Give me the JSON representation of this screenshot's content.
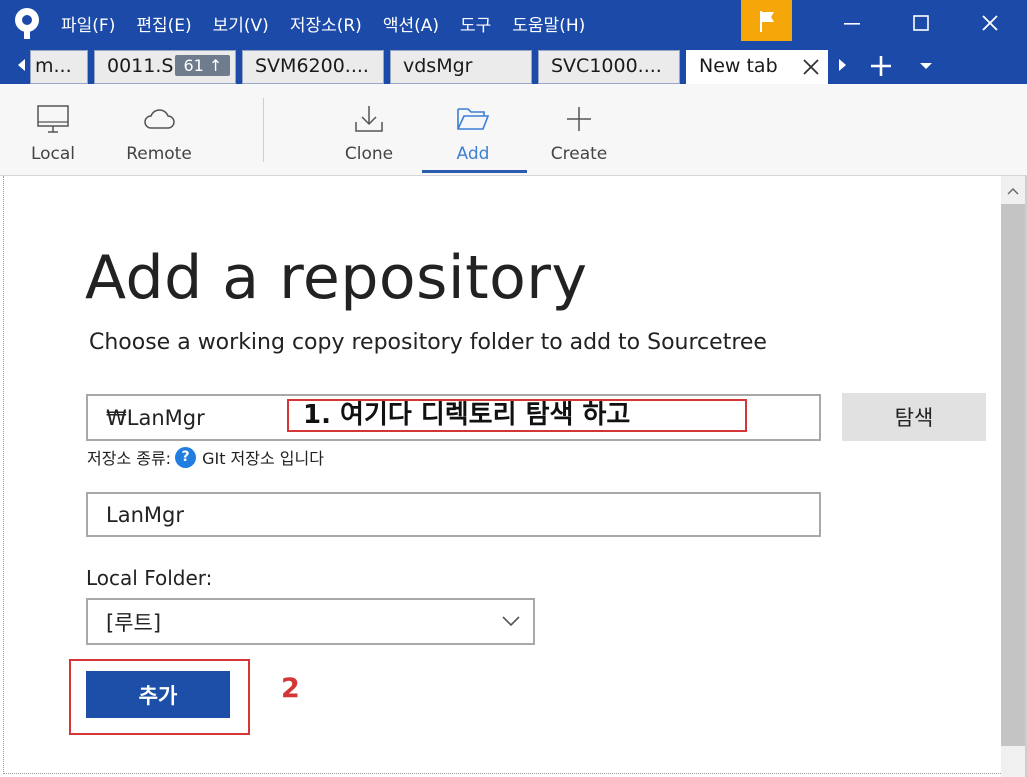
{
  "app": {
    "brand_color": "#1c4aa8",
    "accent_color": "#3d7fd6",
    "flag_color": "#f5a70a",
    "annotation_color": "#d43535"
  },
  "menu": {
    "items": [
      "파일(F)",
      "편집(E)",
      "보기(V)",
      "저장소(R)",
      "액션(A)",
      "도구",
      "도움말(H)"
    ]
  },
  "window": {
    "minimize_icon": "minimize-icon",
    "maximize_icon": "maximize-icon",
    "close_icon": "close-icon",
    "flag_icon": "flag-icon"
  },
  "tabs": {
    "items": [
      {
        "label": "m..."
      },
      {
        "label": "0011.S",
        "badge": "61 ↑"
      },
      {
        "label": "SVM6200...."
      },
      {
        "label": "vdsMgr"
      },
      {
        "label": "SVC1000...."
      },
      {
        "label": "New tab",
        "active": true
      }
    ]
  },
  "toolbar": {
    "local": "Local",
    "remote": "Remote",
    "clone": "Clone",
    "add": "Add",
    "create": "Create",
    "selected": "add"
  },
  "page": {
    "title": "Add a repository",
    "subtitle": "Choose a working copy repository folder to add to Sourcetree"
  },
  "form": {
    "path_value": "₩LanMgr",
    "browse_label": "탐색",
    "repo_type_prefix": "저장소 종류:",
    "repo_type_help": "?",
    "repo_type_text": "GIt 저장소 입니다",
    "name_value": "LanMgr",
    "local_folder_label": "Local Folder:",
    "local_folder_selected": "[루트]",
    "add_button": "추가"
  },
  "annotations": {
    "step1": "1. 여기다 디렉토리 탐색 하고",
    "step2": "2"
  }
}
